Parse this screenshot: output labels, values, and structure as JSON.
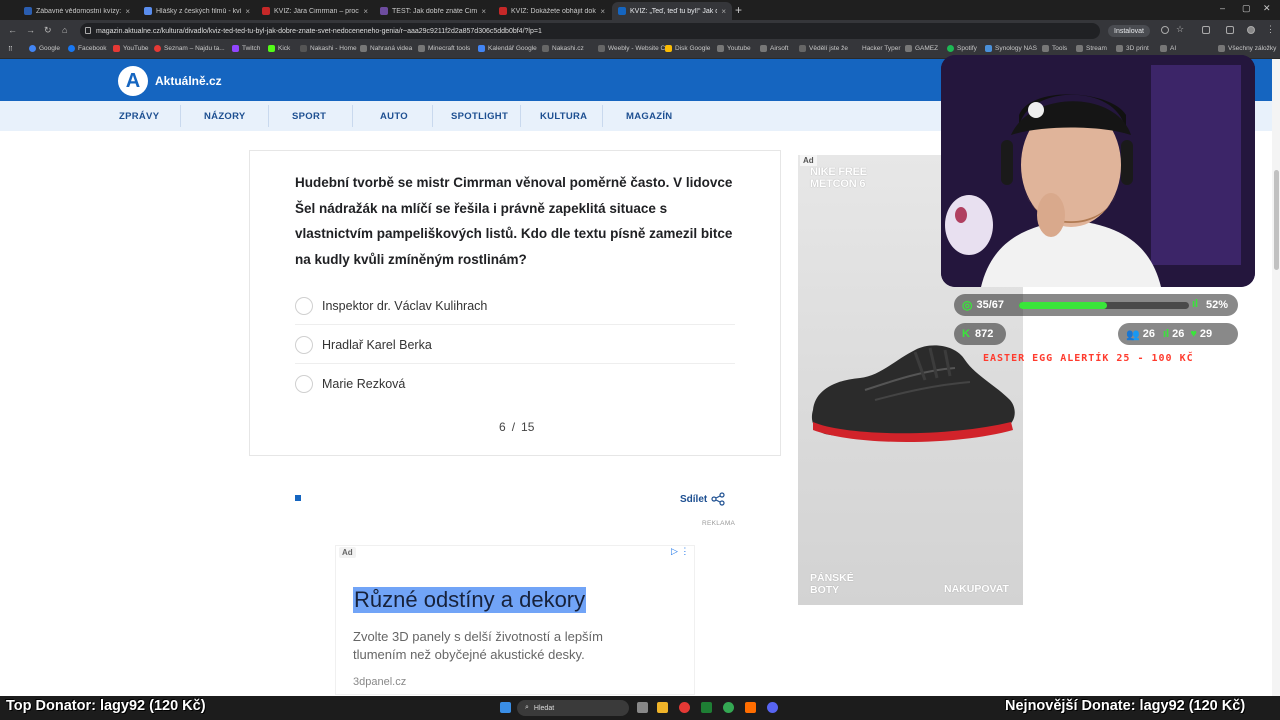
{
  "browser": {
    "tabs": [
      {
        "label": "Zábavné vědomostní kvízy: Ot",
        "color": "#2a5db0"
      },
      {
        "label": "Hlášky z českých filmů - kvíz |",
        "color": "#5a8dee"
      },
      {
        "label": "KVÍZ: Jára Cimrman – procvič",
        "color": "#c62828"
      },
      {
        "label": "TEST: Jak dobře znáte Cimrma",
        "color": "#6d4c9f"
      },
      {
        "label": "KVÍZ: Dokážete obhájit doktor",
        "color": "#c62828"
      },
      {
        "label": "KVÍZ: „Teď, teď tu byl!“ Jak dob",
        "color": "#1565c0"
      }
    ],
    "url": "magazin.aktualne.cz/kultura/divadlo/kviz-ted-ted-tu-byl-jak-dobre-znate-svet-nedoceneneho-genia/r~aaa29c9211f2d2a857d306c5ddb0bf4/?lp=1",
    "install_label": "Instalovat",
    "bookmarks": [
      "Google",
      "Facebook",
      "YouTube",
      "Seznam – Najdu ta...",
      "Twitch",
      "Kick",
      "Nakashi - Home",
      "Nahraná videa",
      "Minecraft tools",
      "Kalendář Google",
      "Nakashi.cz",
      "Weebly - Website C...",
      "Disk Google",
      "Youtube",
      "Airsoft",
      "Vědělí jste že",
      "Hacker Typer",
      "GAMEZ",
      "Spotify",
      "Synology NAS",
      "Tools",
      "Stream",
      "3D print",
      "AI",
      "Všechny záložky"
    ]
  },
  "site": {
    "logo_letter": "A",
    "logo_text": "Aktuálně.cz",
    "nav": [
      "ZPRÁVY",
      "NÁZORY",
      "SPORT",
      "AUTO",
      "SPOTLIGHT",
      "KULTURA",
      "MAGAZÍN"
    ],
    "accent": "#1565c0"
  },
  "quiz": {
    "question": "Hudební tvorbě se mistr Cimrman věnoval poměrně často. V lidovce Šel nádražák na mlíčí se řešila i právně zapeklitá situace s vlastnictvím pampeliškových listů. Kdo dle textu písně zamezil bitce na kudly kvůli zmíněným rostlinám?",
    "answers": [
      "Inspektor dr. Václav Kulihrach",
      "Hradlař Karel Berka",
      "Marie Rezková"
    ],
    "current": "6",
    "separator": "/",
    "total": "15"
  },
  "share": {
    "label": "Sdílet",
    "ad_label": "REKLAMA"
  },
  "bottom_ad": {
    "tag": "Ad",
    "headline": "Různé odstíny a dekory",
    "body": "Zvolte 3D panely s delší životností a lepším tlumením než obyčejné akustické desky.",
    "domain": "3dpanel.cz"
  },
  "side_ad": {
    "tag": "Ad",
    "headline_1": "NIKE FREE",
    "headline_2": "METCON 6",
    "left_1": "PÁNSKÉ",
    "left_2": "BOTY",
    "cta": "NAKUPOVAT"
  },
  "stream_overlay": {
    "progress_text": "35/67",
    "progress_fraction": 0.52,
    "percent": "52%",
    "kick_count": "872",
    "stat_a": "26",
    "stat_b": "26",
    "stat_c": "29",
    "easter": "EASTER EGG ALERTÍK 25 - 100 KČ",
    "top_donator": "Top Donator: lagy92 (120 Kč)",
    "newest_donate": "Nejnovější Donate: lagy92 (120 Kč)"
  },
  "taskbar": {
    "search_label": "Hledat"
  }
}
